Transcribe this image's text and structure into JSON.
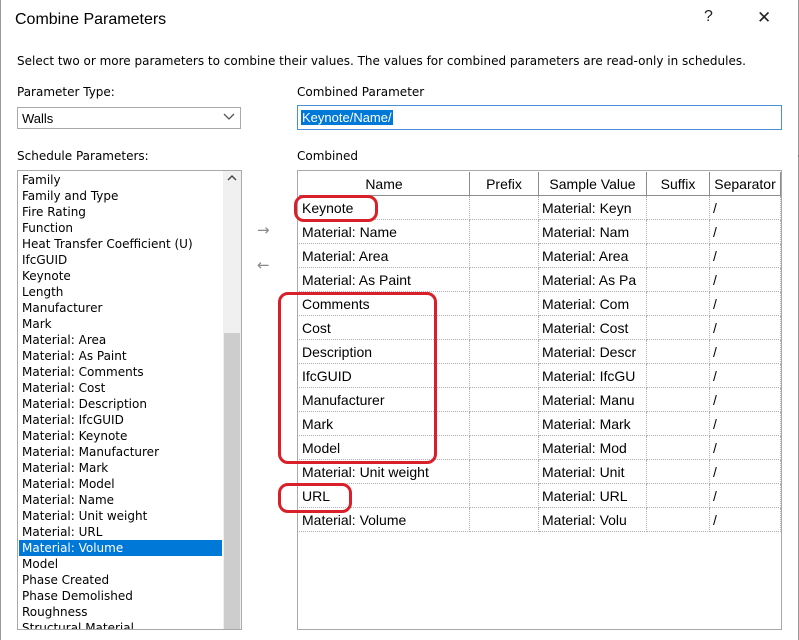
{
  "window": {
    "title": "Combine Parameters",
    "help_label": "?",
    "close_label": "✕"
  },
  "instructions": "Select two or more parameters to combine their values.  The values for combined parameters are read-only in schedules.",
  "parameter_type": {
    "label": "Parameter Type:",
    "value": "Walls"
  },
  "combined_parameter": {
    "label": "Combined Parameter",
    "value": "Keynote/Name/"
  },
  "schedule_parameters": {
    "label": "Schedule Parameters:",
    "items": [
      "Family",
      "Family and Type",
      "Fire Rating",
      "Function",
      "Heat Transfer Coefficient (U)",
      "IfcGUID",
      "Keynote",
      "Length",
      "Manufacturer",
      "Mark",
      "Material: Area",
      "Material: As Paint",
      "Material: Comments",
      "Material: Cost",
      "Material: Description",
      "Material: IfcGUID",
      "Material: Keynote",
      "Material: Manufacturer",
      "Material: Mark",
      "Material: Model",
      "Material: Name",
      "Material: Unit weight",
      "Material: URL",
      "Material: Volume",
      "Model",
      "Phase Created",
      "Phase Demolished",
      "Roughness",
      "Structural Material"
    ],
    "selected": "Material: Volume"
  },
  "arrows": {
    "add": "→",
    "remove": "←"
  },
  "combined": {
    "label": "Combined",
    "columns": [
      "Name",
      "Prefix",
      "Sample Value",
      "Suffix",
      "Separator"
    ],
    "rows": [
      {
        "name": "Keynote",
        "prefix": "",
        "sample": "Material: Keyn",
        "suffix": "",
        "separator": "/"
      },
      {
        "name": "Material: Name",
        "prefix": "",
        "sample": "Material: Nam",
        "suffix": "",
        "separator": "/"
      },
      {
        "name": "Material: Area",
        "prefix": "",
        "sample": "Material: Area",
        "suffix": "",
        "separator": "/"
      },
      {
        "name": "Material: As Paint",
        "prefix": "",
        "sample": "Material: As Pa",
        "suffix": "",
        "separator": "/"
      },
      {
        "name": "Comments",
        "prefix": "",
        "sample": "Material: Com",
        "suffix": "",
        "separator": "/"
      },
      {
        "name": "Cost",
        "prefix": "",
        "sample": "Material: Cost",
        "suffix": "",
        "separator": "/"
      },
      {
        "name": "Description",
        "prefix": "",
        "sample": "Material: Descr",
        "suffix": "",
        "separator": "/"
      },
      {
        "name": "IfcGUID",
        "prefix": "",
        "sample": "Material: IfcGU",
        "suffix": "",
        "separator": "/"
      },
      {
        "name": "Manufacturer",
        "prefix": "",
        "sample": "Material: Manu",
        "suffix": "",
        "separator": "/"
      },
      {
        "name": "Mark",
        "prefix": "",
        "sample": "Material: Mark",
        "suffix": "",
        "separator": "/"
      },
      {
        "name": "Model",
        "prefix": "",
        "sample": "Material: Mod",
        "suffix": "",
        "separator": "/"
      },
      {
        "name": "Material: Unit weight",
        "prefix": "",
        "sample": "Material: Unit",
        "suffix": "",
        "separator": "/"
      },
      {
        "name": "URL",
        "prefix": "",
        "sample": "Material: URL",
        "suffix": "",
        "separator": "/"
      },
      {
        "name": "Material: Volume",
        "prefix": "",
        "sample": "Material: Volu",
        "suffix": "",
        "separator": "/"
      }
    ]
  },
  "colors": {
    "accent": "#0078d7",
    "highlight": "#d9202a"
  },
  "icons": {
    "dropdown": "chevron-down-icon",
    "scroll_up": "scroll-up-arrow-icon"
  }
}
